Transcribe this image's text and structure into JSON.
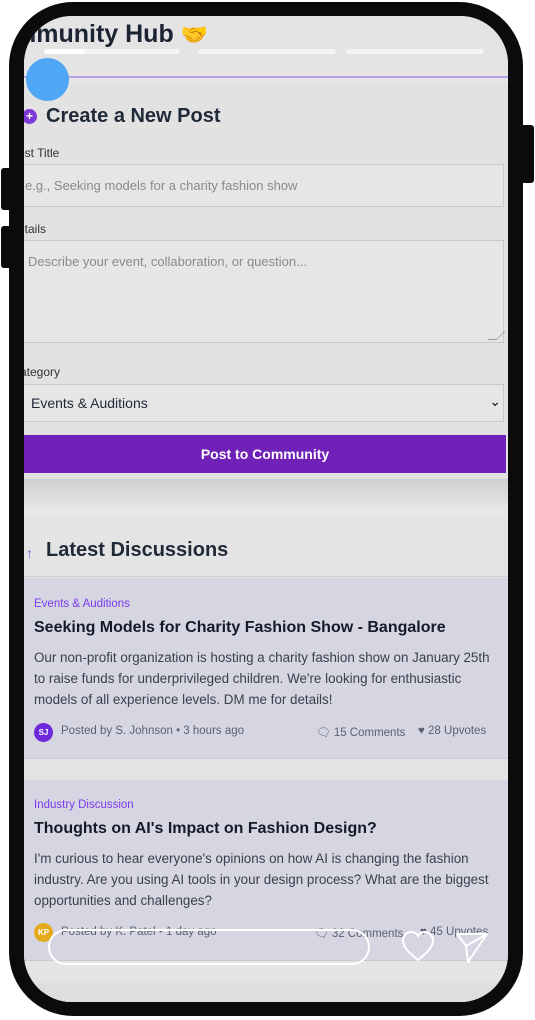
{
  "header": {
    "title": "mmunity Hub",
    "emoji": "🤝"
  },
  "stories": {
    "segments": 3
  },
  "create_post": {
    "heading": "Create a New Post",
    "title_label": "ost Title",
    "title_placeholder": "e.g., Seeking models for a charity fashion show",
    "details_label": "etails",
    "details_placeholder": "Describe your event, collaboration, or question...",
    "category_label": "ategory",
    "category_value": "Events & Auditions",
    "submit_label": "Post to Community"
  },
  "discussions": {
    "heading": "Latest Discussions",
    "posts": [
      {
        "category": "Events & Auditions",
        "title": "Seeking Models for Charity Fashion Show - Bangalore",
        "body": "Our non-profit organization is hosting a charity fashion show on January 25th to raise funds for underprivileged children. We're looking for enthusiastic models of all experience levels. DM me for details!",
        "avatar": "SJ",
        "avatar_color": "#6d28d9",
        "meta": "Posted by S. Johnson • 3 hours ago",
        "comments": "15 Comments",
        "upvotes": "28 Upvotes"
      },
      {
        "category": "Industry Discussion",
        "title": "Thoughts on AI's Impact on Fashion Design?",
        "body": "I'm curious to hear everyone's opinions on how AI is changing the fashion industry. Are you using AI tools in your design process? What are the biggest opportunities and challenges?",
        "avatar": "KP",
        "avatar_color": "#e5a91c",
        "meta": "Posted by K. Patel • 1 day ago",
        "comments": "32 Comments",
        "upvotes": "45 Upvotes"
      }
    ]
  },
  "colors": {
    "accent": "#6f21b8",
    "category": "#7c3aed"
  }
}
